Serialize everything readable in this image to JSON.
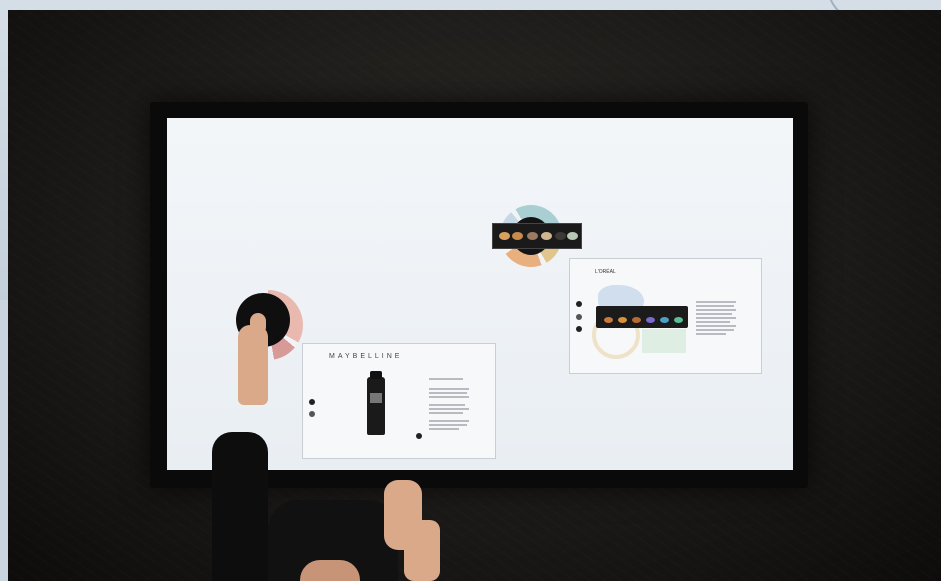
{
  "scene": {
    "description_free": true,
    "maybelline_card": {
      "brand": "MAYBELLINE"
    },
    "loreal_card": {
      "brand": "L'ORÉAL"
    }
  }
}
